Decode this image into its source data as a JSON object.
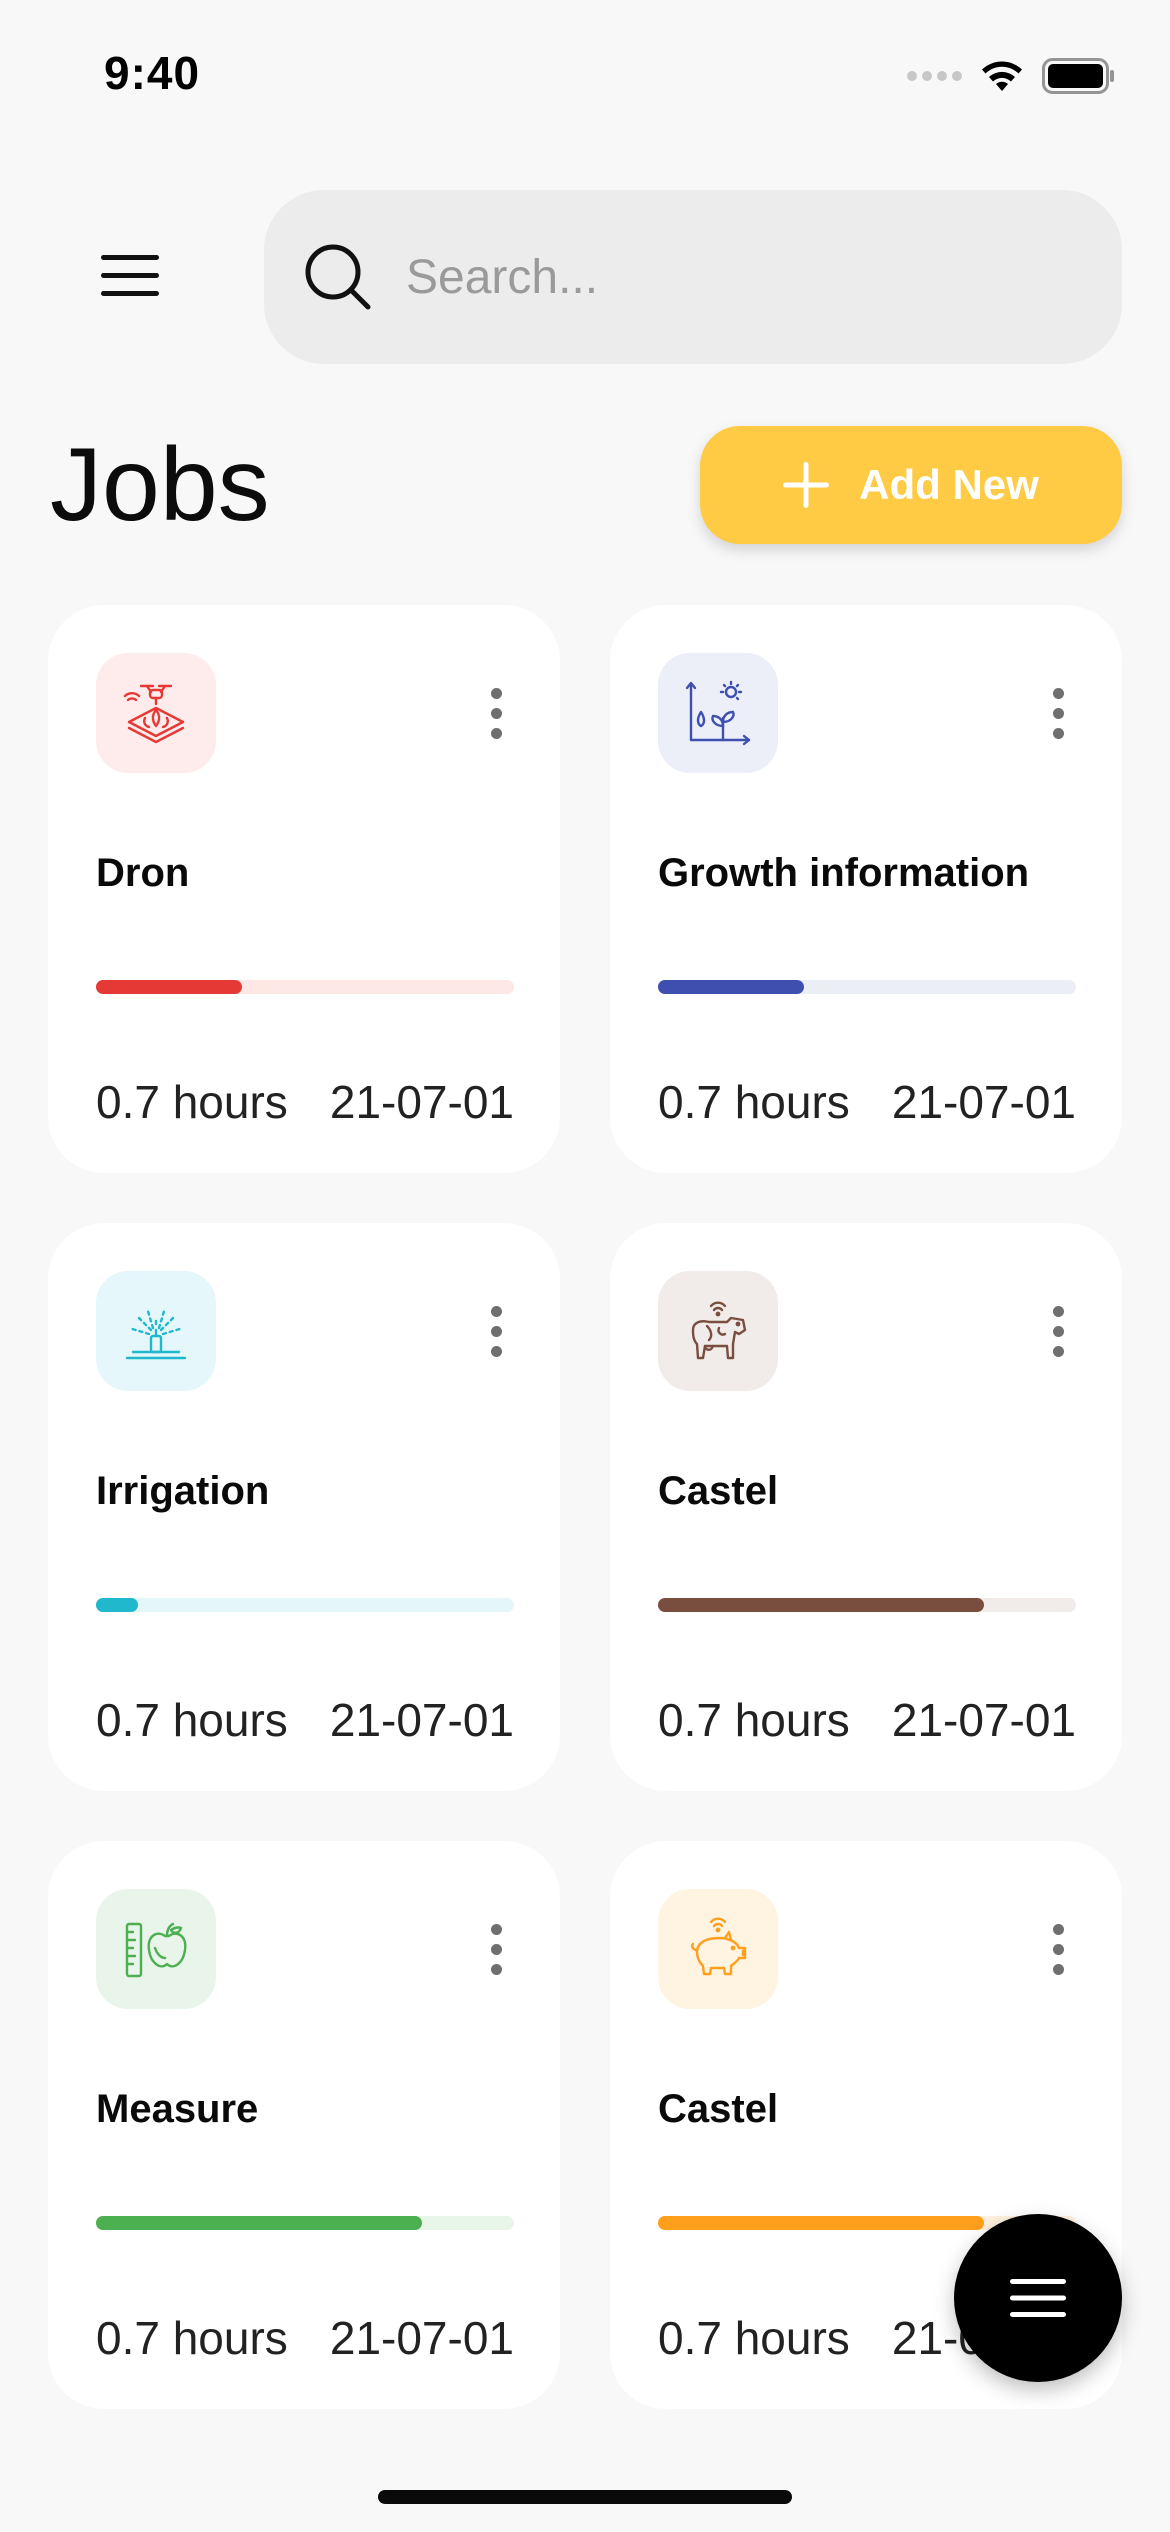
{
  "status_bar": {
    "time": "9:40"
  },
  "header": {
    "search": {
      "placeholder": "Search...",
      "value": ""
    },
    "title": "Jobs",
    "add_button_label": "Add New"
  },
  "colors": {
    "accent": "#ffcb45",
    "background": "#f8f8f8",
    "fab": "#000000"
  },
  "jobs": [
    {
      "title": "Dron",
      "hours": "0.7 hours",
      "date": "21-07-01",
      "icon": "drone-field-icon",
      "color": "#e53935",
      "track_color": "#fde8e6",
      "icon_bg": "#fdeceb",
      "progress": 0.35
    },
    {
      "title": "Growth information",
      "hours": "0.7 hours",
      "date": "21-07-01",
      "icon": "plant-growth-chart-icon",
      "color": "#3f4fb0",
      "track_color": "#eceef6",
      "icon_bg": "#eceef8",
      "progress": 0.35
    },
    {
      "title": "Irrigation",
      "hours": "0.7 hours",
      "date": "21-07-01",
      "icon": "sprinkler-icon",
      "color": "#1fb8cc",
      "track_color": "#e5f6f9",
      "icon_bg": "#e5f7fb",
      "progress": 0.1
    },
    {
      "title": "Castel",
      "hours": "0.7 hours",
      "date": "21-07-01",
      "icon": "cow-icon",
      "color": "#7a4e3e",
      "track_color": "#f1ece9",
      "icon_bg": "#f1ece9",
      "progress": 0.78
    },
    {
      "title": "Measure",
      "hours": "0.7 hours",
      "date": "21-07-01",
      "icon": "ruler-apple-icon",
      "color": "#4caf50",
      "track_color": "#e8f5e9",
      "icon_bg": "#e9f5ea",
      "progress": 0.78
    },
    {
      "title": "Castel",
      "hours": "0.7 hours",
      "date": "21-07-01",
      "icon": "pig-icon",
      "color": "#ff9f1c",
      "track_color": "#fff1de",
      "icon_bg": "#fff3e2",
      "progress": 0.78
    }
  ]
}
